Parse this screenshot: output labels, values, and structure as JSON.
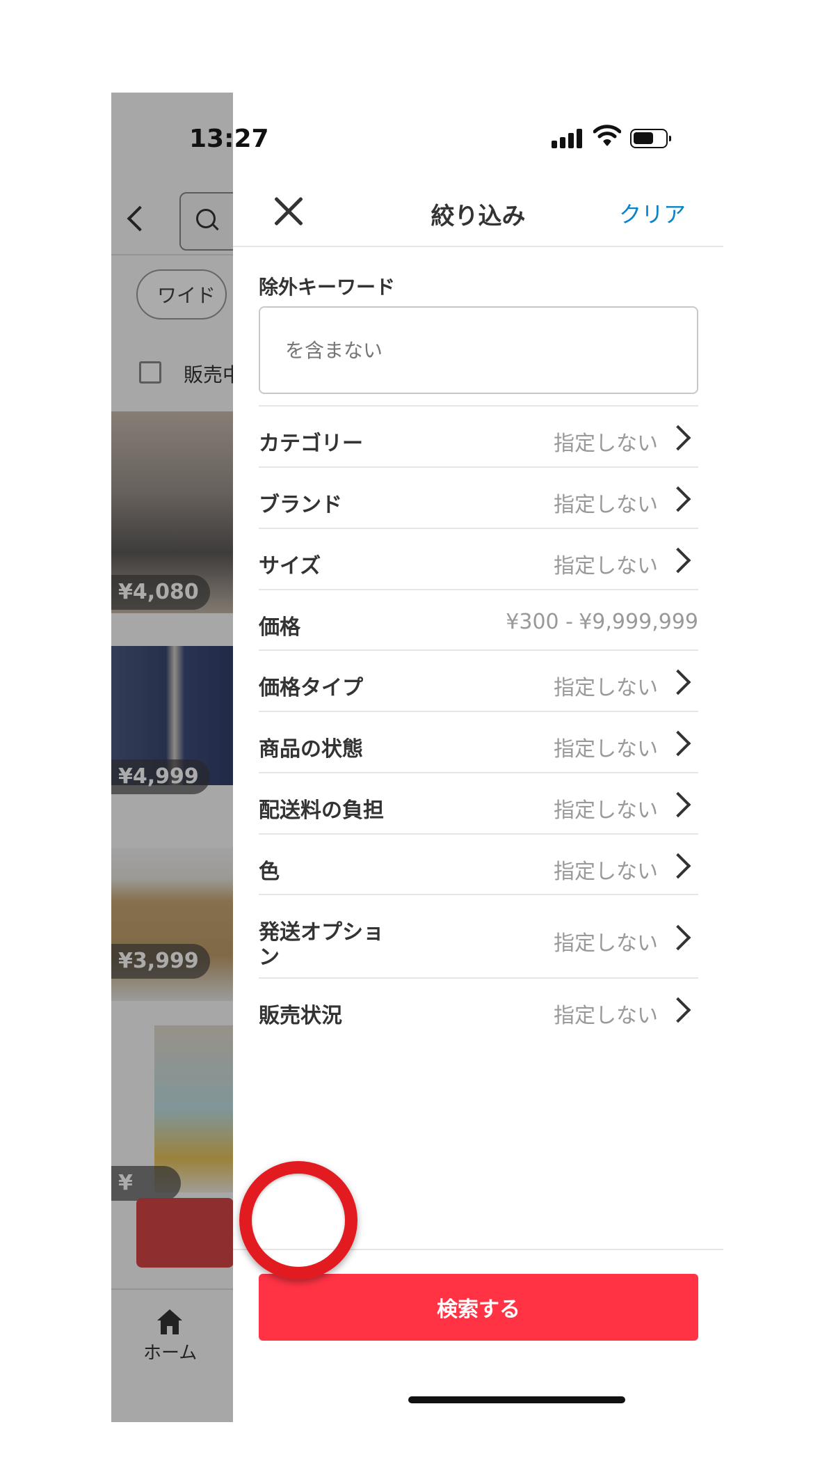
{
  "status_bar": {
    "time": "13:27"
  },
  "background_app": {
    "chip_label": "ワイド",
    "checkbox_label": "販売中",
    "prices": [
      "¥4,080",
      "¥4,999",
      "¥3,999",
      "¥"
    ],
    "tab_home_label": "ホーム"
  },
  "panel": {
    "title": "絞り込み",
    "clear_label": "クリア",
    "exclude_keyword": {
      "label": "除外キーワード",
      "placeholder": "を含まない"
    },
    "rows": [
      {
        "label": "カテゴリー",
        "value": "指定しない"
      },
      {
        "label": "ブランド",
        "value": "指定しない"
      },
      {
        "label": "サイズ",
        "value": "指定しない"
      },
      {
        "label": "価格",
        "min": "¥300 -",
        "max": "¥9,999,999"
      },
      {
        "label": "価格タイプ",
        "value": "指定しない"
      },
      {
        "label": "商品の状態",
        "value": "指定しない"
      },
      {
        "label": "配送料の負担",
        "value": "指定しない"
      },
      {
        "label": "色",
        "value": "指定しない"
      },
      {
        "label_line1": "発送オプショ",
        "label_line2": "ン",
        "value": "指定しない"
      },
      {
        "label": "販売状況",
        "value": "指定しない"
      }
    ],
    "search_button": "検索する"
  },
  "colors": {
    "accent_red": "#ff3344",
    "link_blue": "#0a84c6",
    "highlight_ring": "#e11b20"
  }
}
